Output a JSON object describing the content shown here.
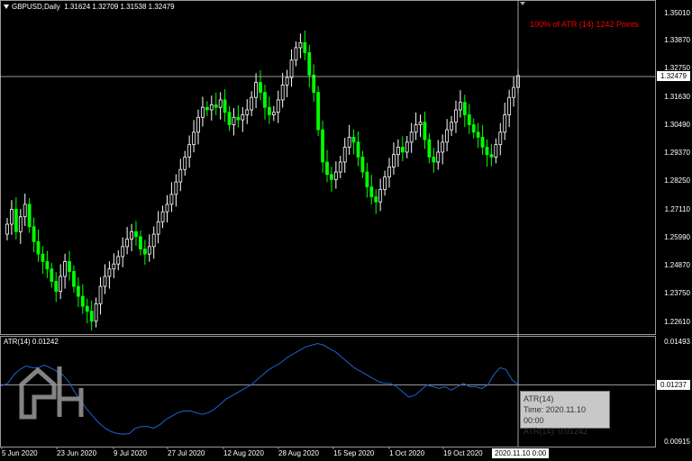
{
  "header": {
    "title": "GBPUSD,Daily",
    "ohlc": "1.31624 1.32709 1.31538 1.32479",
    "atr_note": "100% of ATR (14) 1242 Points"
  },
  "price_axis": {
    "labels": [
      "1.35010",
      "1.33870",
      "1.32750",
      "1.31630",
      "1.30490",
      "1.29370",
      "1.28250",
      "1.27110",
      "1.25990",
      "1.24870",
      "1.23750",
      "1.22610"
    ],
    "current": "1.32479"
  },
  "indicator": {
    "label": "ATR(14) 0.01242",
    "axis_top": "0.01493",
    "axis_bottom": "0.00915",
    "current": "0.01237",
    "tooltip": {
      "name": "ATR(14)",
      "time": "Time: 2020.11.10 00:00",
      "value": "ATR(14): 0.01242"
    }
  },
  "time_axis": {
    "labels": [
      "5 Jun 2020",
      "23 Jun 2020",
      "9 Jul 2020",
      "27 Jul 2020",
      "12 Aug 2020",
      "28 Aug 2020",
      "15 Sep 2020",
      "1 Oct 2020",
      "19 Oct 2020"
    ],
    "cursor": "2020.11.10 0:00"
  },
  "colors": {
    "background": "#000000",
    "bull": "#ffffff",
    "bear": "#00ff00",
    "atr_line": "#1e64d2",
    "note": "#ff0000",
    "grid": "#c8c8c8"
  },
  "chart_data": {
    "type": "candlestick",
    "symbol": "GBPUSD",
    "timeframe": "Daily",
    "ylim": [
      1.223,
      1.353
    ],
    "closes": [
      1.265,
      1.271,
      1.262,
      1.268,
      1.273,
      1.264,
      1.258,
      1.253,
      1.25,
      1.247,
      1.242,
      1.238,
      1.244,
      1.25,
      1.246,
      1.24,
      1.236,
      1.232,
      1.23,
      1.226,
      1.233,
      1.24,
      1.244,
      1.247,
      1.249,
      1.252,
      1.256,
      1.259,
      1.262,
      1.26,
      1.255,
      1.253,
      1.256,
      1.261,
      1.266,
      1.27,
      1.273,
      1.277,
      1.282,
      1.287,
      1.292,
      1.297,
      1.302,
      1.308,
      1.312,
      1.311,
      1.313,
      1.312,
      1.315,
      1.31,
      1.305,
      1.308,
      1.307,
      1.309,
      1.311,
      1.316,
      1.322,
      1.318,
      1.312,
      1.309,
      1.31,
      1.315,
      1.321,
      1.324,
      1.331,
      1.336,
      1.338,
      1.334,
      1.325,
      1.318,
      1.303,
      1.29,
      1.285,
      1.283,
      1.286,
      1.29,
      1.296,
      1.3,
      1.298,
      1.292,
      1.286,
      1.28,
      1.276,
      1.274,
      1.279,
      1.284,
      1.288,
      1.293,
      1.296,
      1.294,
      1.298,
      1.302,
      1.305,
      1.306,
      1.299,
      1.292,
      1.29,
      1.294,
      1.298,
      1.303,
      1.306,
      1.311,
      1.314,
      1.309,
      1.305,
      1.302,
      1.3,
      1.296,
      1.293,
      1.292,
      1.297,
      1.302,
      1.309,
      1.316,
      1.32,
      1.3248
    ],
    "atr": {
      "name": "ATR(14)",
      "ylim": [
        0.00915,
        0.01493
      ],
      "values": [
        0.01235,
        0.0125,
        0.013,
        0.0133,
        0.0135,
        0.0134,
        0.0134,
        0.01355,
        0.0134,
        0.0132,
        0.013,
        0.0126,
        0.012,
        0.0115,
        0.011,
        0.0106,
        0.0102,
        0.0099,
        0.0097,
        0.0096,
        0.00955,
        0.0096,
        0.0099,
        0.01,
        0.01,
        0.0099,
        0.0101,
        0.0104,
        0.0106,
        0.0108,
        0.0109,
        0.0109,
        0.0108,
        0.0107,
        0.0108,
        0.011,
        0.0113,
        0.0116,
        0.0118,
        0.012,
        0.0122,
        0.0124,
        0.0127,
        0.013,
        0.0133,
        0.0135,
        0.0137,
        0.014,
        0.0142,
        0.0144,
        0.0146,
        0.0147,
        0.0148,
        0.0147,
        0.0145,
        0.0143,
        0.014,
        0.0137,
        0.0134,
        0.0132,
        0.013,
        0.0128,
        0.0126,
        0.0125,
        0.0125,
        0.0123,
        0.012,
        0.0117,
        0.0118,
        0.0121,
        0.0124,
        0.0123,
        0.0122,
        0.0123,
        0.0121,
        0.0123,
        0.0125,
        0.0123,
        0.0123,
        0.0122,
        0.0124,
        0.013,
        0.0134,
        0.0133,
        0.0127,
        0.01242
      ]
    }
  }
}
